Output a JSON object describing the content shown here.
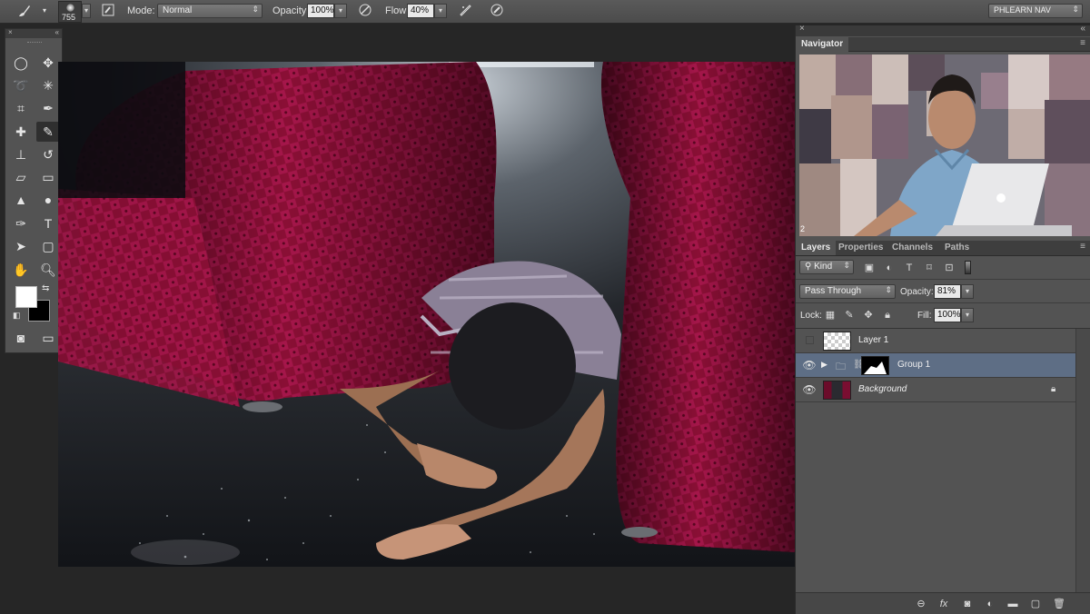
{
  "options_bar": {
    "brush_size": "755",
    "mode_label": "Mode:",
    "mode_value": "Normal",
    "opacity_label": "Opacity:",
    "opacity_value": "100%",
    "flow_label": "Flow:",
    "flow_value": "40%",
    "workspace": "PHLEARN NAV"
  },
  "navigator": {
    "tab": "Navigator",
    "corner_number": "2"
  },
  "layers_panel": {
    "tabs": [
      "Layers",
      "Properties",
      "Channels",
      "Paths"
    ],
    "filter_label": "Kind",
    "blend_mode": "Pass Through",
    "opacity_label": "Opacity:",
    "opacity_value": "81%",
    "lock_label": "Lock:",
    "fill_label": "Fill:",
    "fill_value": "100%",
    "layers": [
      {
        "name": "Layer 1",
        "visible": false
      },
      {
        "name": "Group 1",
        "visible": true,
        "selected": true
      },
      {
        "name": "Background",
        "visible": true,
        "locked": true
      }
    ]
  },
  "colors": {
    "ui_panel": "#535353",
    "selected_layer": "#5e6e85",
    "accent_red": "#8a0f35"
  }
}
